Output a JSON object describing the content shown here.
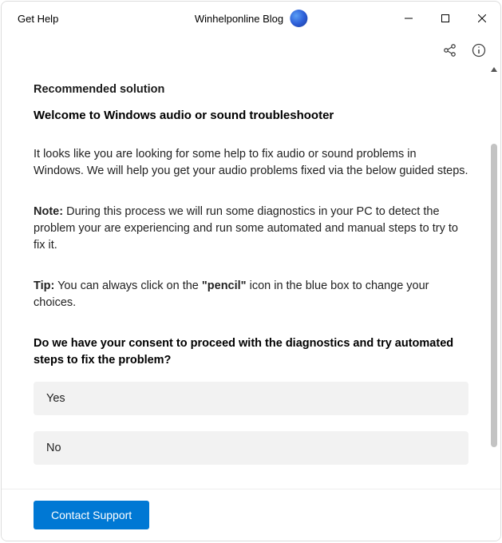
{
  "titlebar": {
    "app_name": "Get Help",
    "blog_title": "Winhelponline Blog"
  },
  "content": {
    "section_label": "Recommended solution",
    "heading": "Welcome to Windows audio or sound troubleshooter",
    "intro": "It looks like you are looking for some help to fix audio or sound problems in Windows. We will help you get your audio problems fixed via the below guided steps.",
    "note_label": "Note:",
    "note_text": " During this process we will run some diagnostics in your PC to detect the problem your are experiencing and run some automated  and manual steps to try to fix it.",
    "tip_label": "Tip:",
    "tip_pre": " You can always click on the ",
    "tip_bold": "\"pencil\"",
    "tip_post": " icon in the blue box to change your choices.",
    "consent_question": "Do we have your consent to proceed with the diagnostics and try automated steps to fix the problem?",
    "option_yes": "Yes",
    "option_no": "No"
  },
  "footer": {
    "contact_label": "Contact Support"
  }
}
